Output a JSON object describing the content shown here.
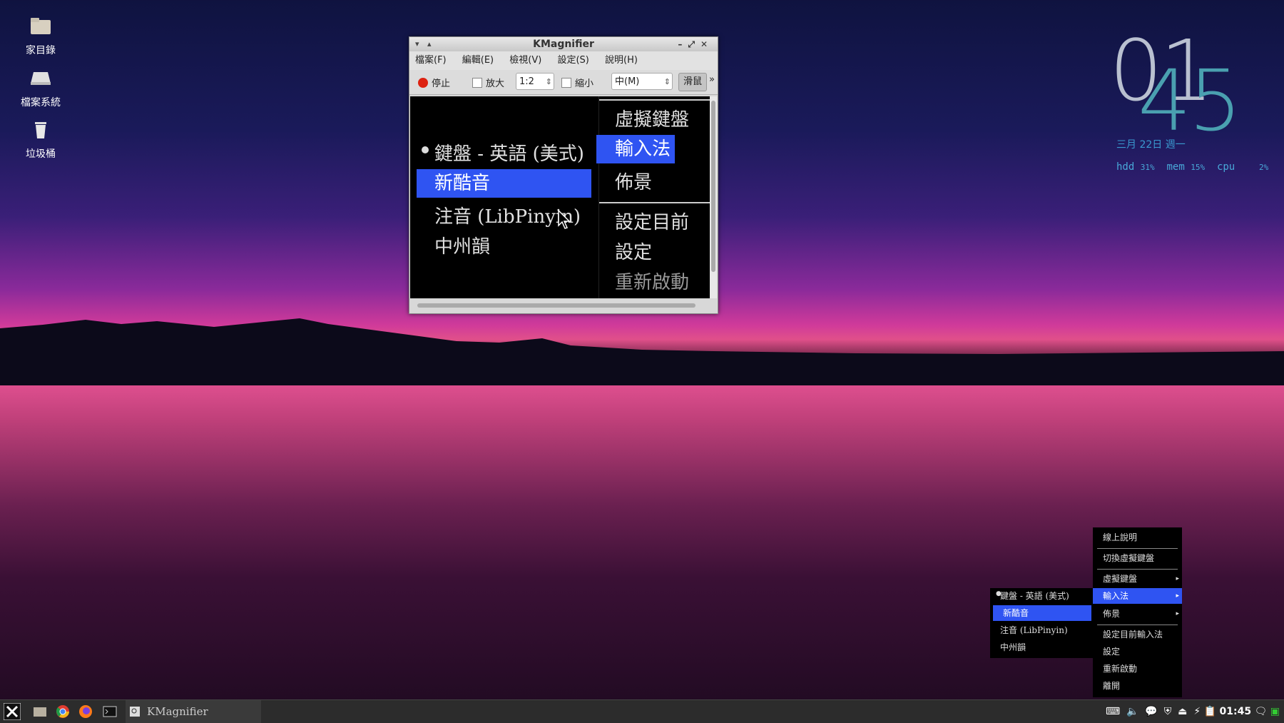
{
  "desktop": {
    "icons": [
      {
        "label": "家目錄",
        "icon": "home-folder-icon"
      },
      {
        "label": "檔案系統",
        "icon": "drive-icon"
      },
      {
        "label": "垃圾桶",
        "icon": "trash-icon"
      }
    ]
  },
  "clock": {
    "hours": "01",
    "minutes": "45",
    "date": "三月 22日 週一"
  },
  "sysmon": {
    "hdd_label": "hdd",
    "hdd_value": "31%",
    "mem_label": "mem",
    "mem_value": "15%",
    "cpu_label": "cpu",
    "cpu_value": "2%"
  },
  "window": {
    "title": "KMagnifier",
    "menus": [
      "檔案(F)",
      "編輯(E)",
      "檢視(V)",
      "設定(S)",
      "說明(H)"
    ],
    "toolbar": {
      "stop": "停止",
      "zoom_in": "放大",
      "ratio": "1:2",
      "zoom_out": "縮小",
      "refresh": "中(M)",
      "mouse": "滑鼠",
      "more": "»"
    },
    "zoomed_left": [
      "鍵盤 - 英語 (美式)",
      "新酷音",
      "注音 (LibPinyin)",
      "中州韻"
    ],
    "zoomed_right": [
      "虛擬鍵盤",
      "輸入法",
      "佈景",
      "設定目前",
      "設定",
      "重新啟動"
    ]
  },
  "tray_menu": {
    "items": [
      "線上說明",
      "切換虛擬鍵盤",
      "虛擬鍵盤",
      "輸入法",
      "佈景",
      "設定目前輸入法",
      "設定",
      "重新啟動",
      "離開"
    ]
  },
  "im_submenu": {
    "items": [
      "鍵盤 - 英語 (美式)",
      "新酷音",
      "注音 (LibPinyin)",
      "中州韻"
    ]
  },
  "taskbar": {
    "task_label": "KMagnifier",
    "time": "01:45"
  },
  "colors": {
    "highlight": "#2f54f2",
    "taskbar": "#2c2c2c"
  }
}
